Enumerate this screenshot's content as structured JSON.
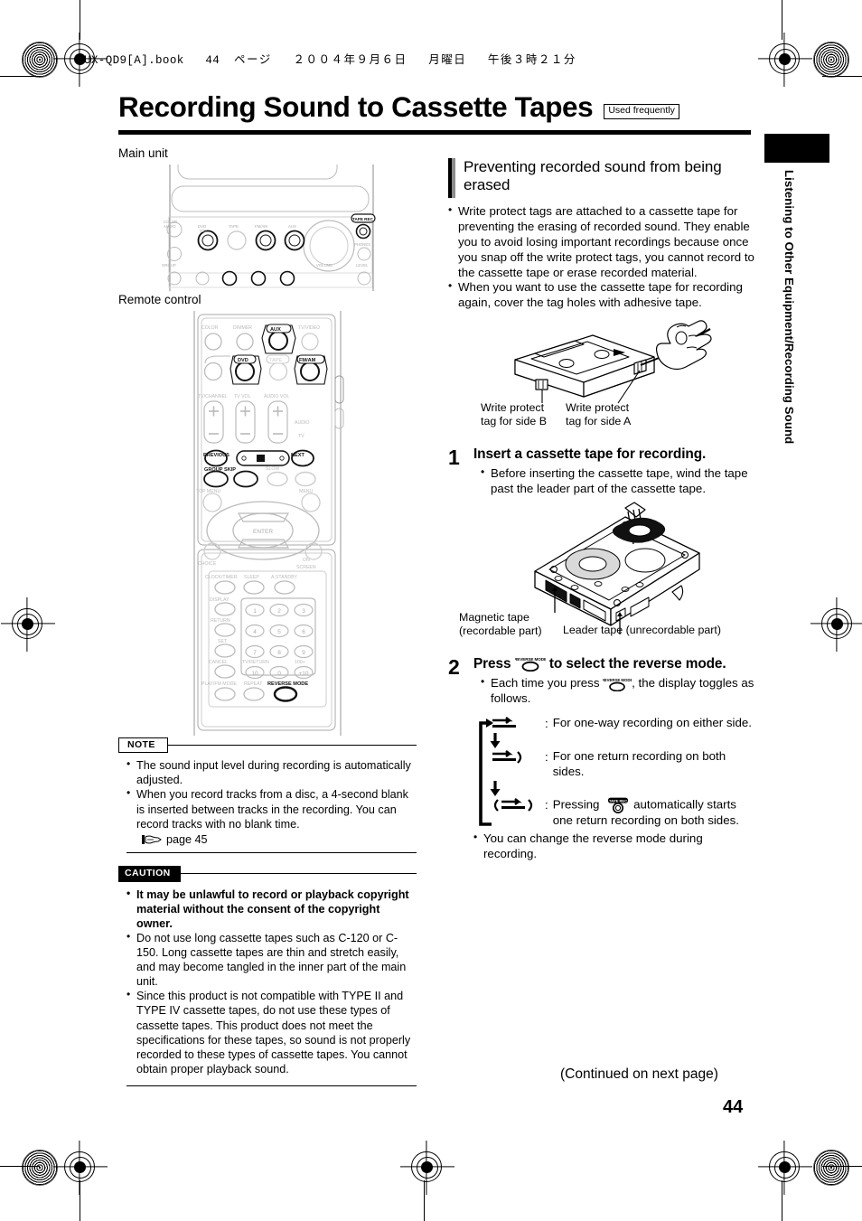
{
  "header": {
    "meta_latin": "UX-QD9[A].book",
    "meta_page": "44",
    "meta_jp_page_word": "ページ",
    "meta_date": "２００４年９月６日",
    "meta_weekday": "月曜日",
    "meta_time": "午後３時２１分"
  },
  "title": {
    "text": "Recording Sound to Cassette Tapes",
    "badge": "Used frequently"
  },
  "side_tab": {
    "vertical_text": "Listening to Other Equipment/Recording Sound"
  },
  "left_column": {
    "main_unit_label": "Main unit",
    "remote_control_label": "Remote control",
    "main_unit_buttons": {
      "standby": "⏻",
      "color_audio": "COLOR\nAUDIO",
      "dvd_cd": "DVD\n/CD",
      "tape": "TAPE\n◄►",
      "fm_am": "FM/AM",
      "aux": "AUX",
      "tape_rec": "TAPE REC",
      "volume": "VOLUME",
      "group": "GROUP",
      "phones": "PHONES",
      "level": "LEVEL"
    },
    "remote_buttons": {
      "row1": [
        "COLOR",
        "DIMMER",
        "AUX",
        "TV/VIDEO"
      ],
      "row2": [
        "DVD",
        "TAPE",
        "FM/AM"
      ],
      "row3": [
        "TV/CHANNEL",
        "TV VOL",
        "AUDIO VOL"
      ],
      "audio_tv": [
        "AUDIO",
        "TV"
      ],
      "prev": "PREVIOUS",
      "next": "NEXT",
      "group_skip": "GROUP SKIP",
      "slow": "SLOW",
      "top_menu": "TOP MENU",
      "menu": "MENU",
      "enter": "ENTER",
      "choice": "CHOICE",
      "on_screen": "ON\nSCREEN",
      "clock_timer": "CLOCK/TIMER",
      "sleep": "SLEEP",
      "a_standby": "A.STANDBY",
      "display": "DISPLAY",
      "return": "RETURN",
      "set": "SET",
      "cancel": "CANCEL",
      "tv_return": "TV/RETURN",
      "hundred_plus": "100+",
      "plus10": "+10",
      "keys": [
        "1",
        "2",
        "3",
        "4",
        "5",
        "6",
        "7",
        "8",
        "9",
        "10",
        "0"
      ],
      "play_fm_mode": "PLAY/FM MODE",
      "repeat": "REPEAT",
      "reverse_mode": "REVERSE MODE"
    },
    "note": {
      "tag": "NOTE",
      "items": [
        "The sound input level during recording is automatically adjusted.",
        "When you record tracks from a disc, a 4-second blank is inserted between tracks in the recording. You can record tracks with no blank time."
      ],
      "page_ref": "page 45"
    },
    "caution": {
      "tag": "CAUTION",
      "items": [
        {
          "bold": true,
          "text": "It may be unlawful to record or playback copyright material without the consent of the copyright owner."
        },
        {
          "bold": false,
          "text": "Do not use long cassette tapes such as C-120 or C-150. Long cassette tapes are thin and stretch easily, and may become tangled in the inner part of the main unit."
        },
        {
          "bold": false,
          "text": "Since this product is not compatible with TYPE II and TYPE IV cassette tapes, do not use these types of cassette tapes. This product does not meet the specifications for these tapes, so sound is not properly recorded to these types of cassette tapes. You cannot obtain proper playback sound."
        }
      ]
    }
  },
  "right_column": {
    "section": {
      "heading": "Preventing recorded sound from being erased",
      "bullets": [
        "Write protect tags are attached to a cassette tape for preventing the erasing of recorded sound. They enable you to avoid losing important recordings because once you snap off the write protect tags, you cannot record to the cassette tape or erase recorded material.",
        "When you want to use the cassette tape for recording again, cover the tag holes with adhesive tape."
      ]
    },
    "figure_tags": {
      "side_b": "Write protect\ntag for side B",
      "side_a": "Write protect\ntag for side A"
    },
    "step1": {
      "number": "1",
      "title": "Insert a cassette tape for recording.",
      "bullets": [
        "Before inserting the cassette tape, wind the tape past the leader part of the cassette tape."
      ]
    },
    "figure_tape": {
      "magnetic": "Magnetic tape\n(recordable part)",
      "leader": "Leader tape (unrecordable part)"
    },
    "step2": {
      "number": "2",
      "title_pre": "Press",
      "title_post": "to select the reverse mode.",
      "button_label": "REVERSE MODE",
      "bullet_pre": "Each time you press",
      "bullet_post": ", the display toggles as follows.",
      "modes": [
        {
          "glyph": "one-way",
          "text": "For one-way recording on either side."
        },
        {
          "glyph": "one-return",
          "text": "For one return recording on both sides."
        },
        {
          "glyph": "auto-return",
          "text_pre": "Pressing",
          "button_label": "TAPE REC",
          "text_post": "automatically starts one return recording on both sides."
        }
      ],
      "closing_bullet": "You can change the reverse mode during recording."
    }
  },
  "footer": {
    "continued": "(Continued on next page)",
    "page_number": "44"
  }
}
